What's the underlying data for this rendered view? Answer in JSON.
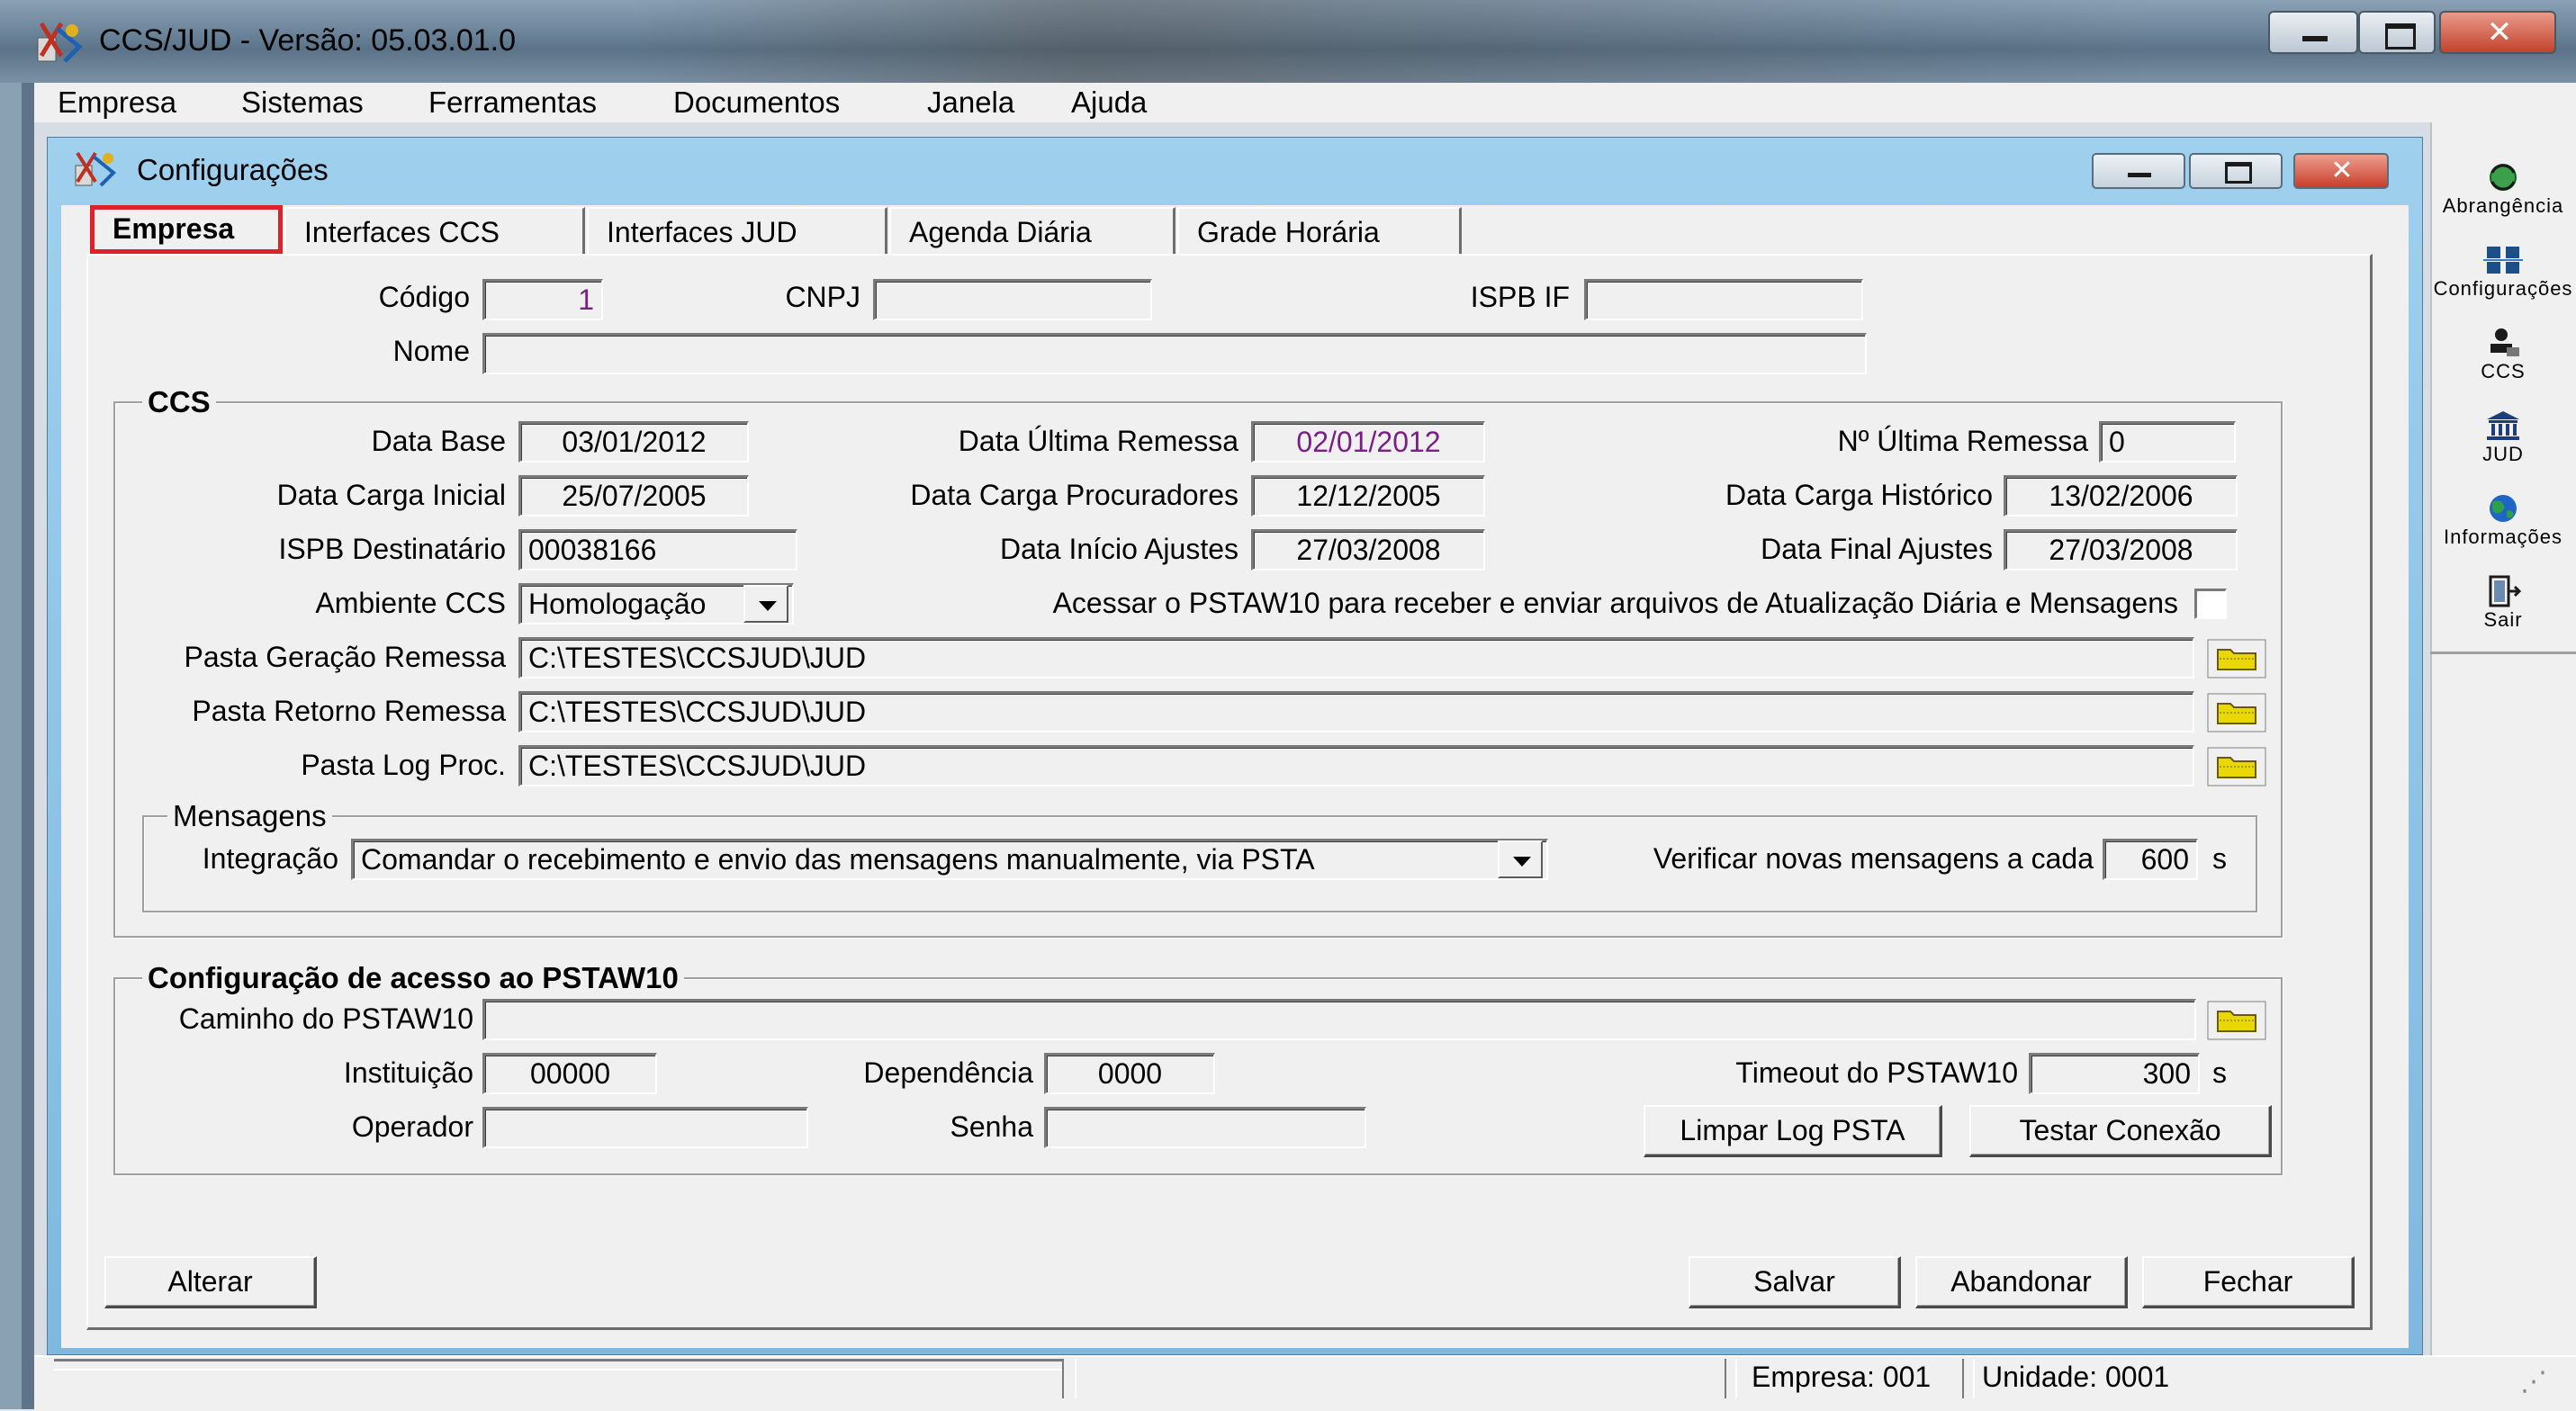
{
  "app": {
    "title": "CCS/JUD - Versão: 05.03.01.0"
  },
  "menu": [
    "Empresa",
    "Sistemas",
    "Ferramentas",
    "Documentos",
    "Janela",
    "Ajuda"
  ],
  "child_window": {
    "title": "Configurações"
  },
  "tabs": [
    {
      "label": "Empresa",
      "active": true
    },
    {
      "label": "Interfaces CCS",
      "active": false
    },
    {
      "label": "Interfaces JUD",
      "active": false
    },
    {
      "label": "Agenda Diária",
      "active": false
    },
    {
      "label": "Grade Horária",
      "active": false
    }
  ],
  "empresa": {
    "codigo_label": "Código",
    "codigo_value": "1",
    "cnpj_label": "CNPJ",
    "cnpj_value": "",
    "ispb_if_label": "ISPB IF",
    "ispb_if_value": "",
    "nome_label": "Nome",
    "nome_value": ""
  },
  "ccs": {
    "group_title": "CCS",
    "data_base_label": "Data Base",
    "data_base": "03/01/2012",
    "data_ultima_remessa_label": "Data Última Remessa",
    "data_ultima_remessa": "02/01/2012",
    "n_ultima_remessa_label": "Nº Última Remessa",
    "n_ultima_remessa": "0",
    "data_carga_inicial_label": "Data Carga Inicial",
    "data_carga_inicial": "25/07/2005",
    "data_carga_procuradores_label": "Data Carga Procuradores",
    "data_carga_procuradores": "12/12/2005",
    "data_carga_historico_label": "Data Carga Histórico",
    "data_carga_historico": "13/02/2006",
    "ispb_destinatario_label": "ISPB Destinatário",
    "ispb_destinatario": "00038166",
    "data_inicio_ajustes_label": "Data Início Ajustes",
    "data_inicio_ajustes": "27/03/2008",
    "data_final_ajustes_label": "Data Final Ajustes",
    "data_final_ajustes": "27/03/2008",
    "ambiente_label": "Ambiente CCS",
    "ambiente": "Homologação",
    "pstaw10_check_label": "Acessar o PSTAW10 para receber e enviar arquivos de Atualização Diária e Mensagens",
    "pasta_geracao_label": "Pasta Geração Remessa",
    "pasta_geracao": "C:\\TESTES\\CCSJUD\\JUD",
    "pasta_retorno_label": "Pasta Retorno Remessa",
    "pasta_retorno": "C:\\TESTES\\CCSJUD\\JUD",
    "pasta_log_label": "Pasta Log Proc.",
    "pasta_log": "C:\\TESTES\\CCSJUD\\JUD"
  },
  "mensagens": {
    "group_title": "Mensagens",
    "integracao_label": "Integração",
    "integracao": "Comandar o recebimento e envio das mensagens manualmente, via PSTA",
    "verificar_label": "Verificar novas mensagens a cada",
    "verificar_value": "600",
    "unit": "s"
  },
  "pstaw10": {
    "group_title": "Configuração de acesso ao PSTAW10",
    "caminho_label": "Caminho do PSTAW10",
    "caminho": "",
    "instituicao_label": "Instituição",
    "instituicao": "00000",
    "dependencia_label": "Dependência",
    "dependencia": "0000",
    "timeout_label": "Timeout do PSTAW10",
    "timeout": "300",
    "unit": "s",
    "operador_label": "Operador",
    "operador": "",
    "senha_label": "Senha",
    "senha": "",
    "limpar_log_button": "Limpar Log PSTA",
    "testar_conexao_button": "Testar Conexão"
  },
  "footer_buttons": {
    "alterar": "Alterar",
    "salvar": "Salvar",
    "abandonar": "Abandonar",
    "fechar": "Fechar"
  },
  "toolbar": [
    {
      "label": "Abrangência",
      "icon": "refresh-globe-icon"
    },
    {
      "label": "Configurações",
      "icon": "config-grid-icon"
    },
    {
      "label": "CCS",
      "icon": "ccs-person-icon"
    },
    {
      "label": "JUD",
      "icon": "courthouse-icon"
    },
    {
      "label": "Informações",
      "icon": "globe-icon"
    },
    {
      "label": "Sair",
      "icon": "exit-door-icon"
    }
  ],
  "status": {
    "empresa": "Empresa: 001",
    "unidade": "Unidade: 0001"
  },
  "colors": {
    "active_tab_border": "#e0202a",
    "purple_value": "#7b1f86",
    "child_frame": "#8fc4e6"
  }
}
